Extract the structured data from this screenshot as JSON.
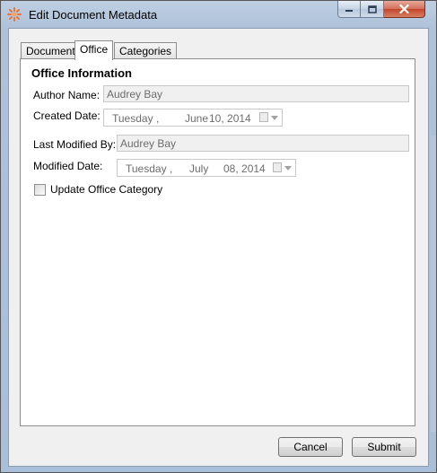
{
  "window": {
    "title": "Edit Document Metadata",
    "icon": "sunburst-app-icon"
  },
  "caption_buttons": {
    "minimize_icon": "minimize-icon",
    "maximize_icon": "maximize-icon",
    "close_icon": "close-icon"
  },
  "tabs": [
    {
      "label": "Document",
      "active": false
    },
    {
      "label": "Office",
      "active": true
    },
    {
      "label": "Categories",
      "active": false
    }
  ],
  "office": {
    "section_title": "Office Information",
    "author_label": "Author Name:",
    "author_value": "Audrey Bay",
    "created_label": "Created Date:",
    "created_date": {
      "weekday": "Tuesday",
      "month": "June",
      "day_year": "10, 2014"
    },
    "last_modified_by_label": "Last Modified By:",
    "last_modified_by_value": "Audrey Bay",
    "modified_label": "Modified Date:",
    "modified_date": {
      "weekday": "Tuesday",
      "month": "July",
      "day_year": "08, 2014"
    },
    "date_separator": ",",
    "update_category_label": "Update Office Category",
    "update_category_checked": false
  },
  "buttons": {
    "cancel": "Cancel",
    "submit": "Submit"
  },
  "colors": {
    "accent_icon": "#e8743b",
    "window_frame": "#a9bed8",
    "close_button": "#c3462b"
  }
}
